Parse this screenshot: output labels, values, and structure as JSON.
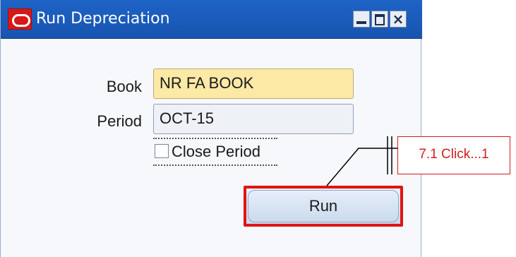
{
  "window": {
    "title": "Run Depreciation"
  },
  "form": {
    "book_label": "Book",
    "book_value": "NR FA BOOK",
    "period_label": "Period",
    "period_value": "OCT-15",
    "close_period_label": "Close Period",
    "close_period_checked": false,
    "run_label": "Run"
  },
  "callout": {
    "text": "7.1 Click...1",
    "color": "#d41c1c"
  },
  "icons": [
    "oracle-logo-icon",
    "minimize-icon",
    "maximize-icon",
    "close-icon"
  ]
}
